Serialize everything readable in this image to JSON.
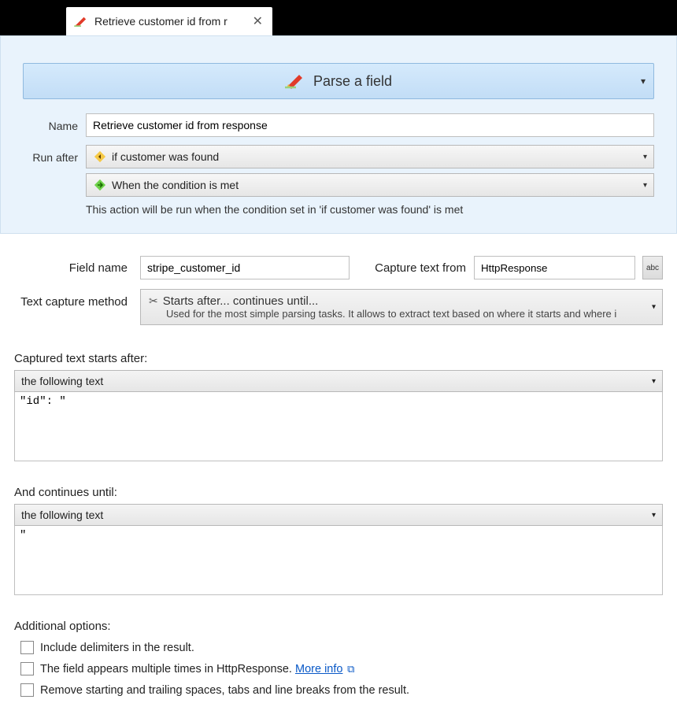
{
  "tab": {
    "title": "Retrieve customer id from r"
  },
  "action_banner": {
    "label": "Parse a field"
  },
  "header_form": {
    "name_label": "Name",
    "name_value": "Retrieve customer id from response",
    "run_after_label": "Run after",
    "run_after_parent": "if customer was found",
    "run_after_condition": "When the condition is met",
    "run_after_note": "This action will be run when the condition set in 'if customer was found' is met"
  },
  "main_form": {
    "field_name_label": "Field name",
    "field_name_value": "stripe_customer_id",
    "capture_from_label": "Capture text from",
    "capture_from_value": "HttpResponse",
    "abc_button": "abc",
    "method_label": "Text capture method",
    "method_title": "Starts after... continues until...",
    "method_desc": "Used for the most simple parsing tasks. It allows to extract text based on where it starts and where i"
  },
  "starts_after": {
    "label": "Captured text starts after:",
    "mode": "the following text",
    "value": "\"id\": \""
  },
  "continues_until": {
    "label": "And continues until:",
    "mode": "the following text",
    "value": "\""
  },
  "options": {
    "heading": "Additional options:",
    "include_delims": "Include delimiters in the result.",
    "multiple_prefix": "The field appears multiple times in HttpResponse. ",
    "more_info": "More info",
    "trim": "Remove starting and trailing spaces, tabs and line breaks from the result."
  }
}
